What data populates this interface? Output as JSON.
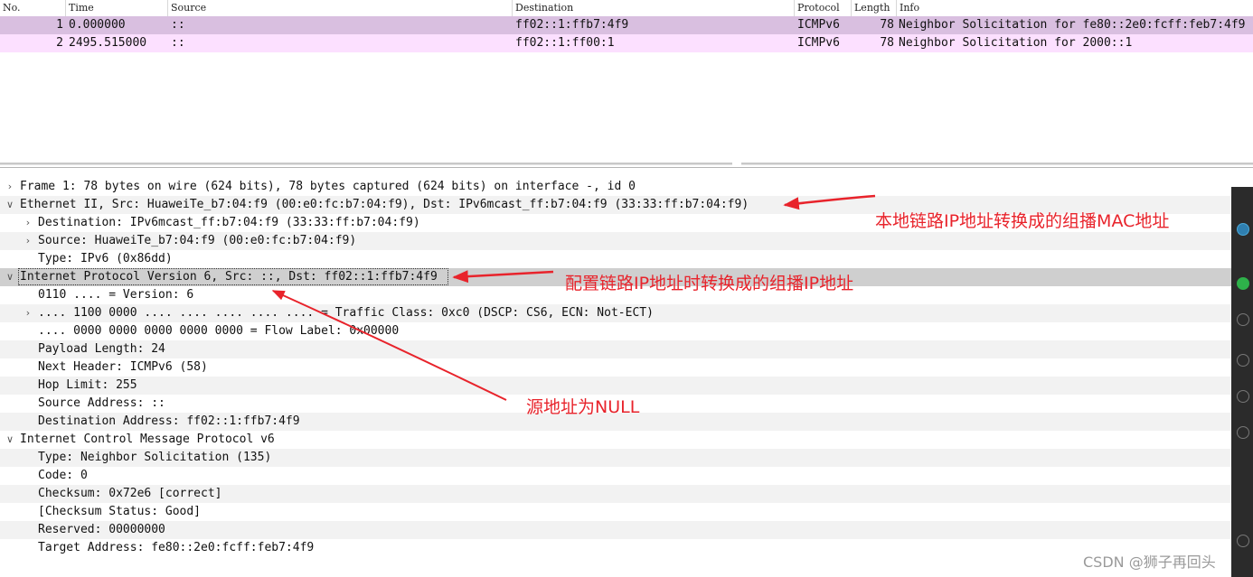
{
  "packet_list": {
    "columns": [
      "No.",
      "Time",
      "Source",
      "Destination",
      "Protocol",
      "Length",
      "Info"
    ],
    "rows": [
      {
        "no": "1",
        "time": "0.000000",
        "source": "::",
        "destination": "ff02::1:ffb7:4f9",
        "protocol": "ICMPv6",
        "length": "78",
        "info": "Neighbor Solicitation for fe80::2e0:fcff:feb7:4f9",
        "bg": "#d9bfe0"
      },
      {
        "no": "2",
        "time": "2495.515000",
        "source": "::",
        "destination": "ff02::1:ff00:1",
        "protocol": "ICMPv6",
        "length": "78",
        "info": "Neighbor Solicitation for 2000::1",
        "bg": "#fce0ff"
      }
    ]
  },
  "details": [
    {
      "text": "Frame 1: 78 bytes on wire (624 bits), 78 bytes captured (624 bits) on interface -, id 0",
      "indent": 0,
      "caret": "collapsed"
    },
    {
      "text": "Ethernet II, Src: HuaweiTe_b7:04:f9 (00:e0:fc:b7:04:f9), Dst: IPv6mcast_ff:b7:04:f9 (33:33:ff:b7:04:f9)",
      "indent": 0,
      "caret": "expanded"
    },
    {
      "text": "Destination: IPv6mcast_ff:b7:04:f9 (33:33:ff:b7:04:f9)",
      "indent": 1,
      "caret": "collapsed"
    },
    {
      "text": "Source: HuaweiTe_b7:04:f9 (00:e0:fc:b7:04:f9)",
      "indent": 1,
      "caret": "collapsed"
    },
    {
      "text": "Type: IPv6 (0x86dd)",
      "indent": 1,
      "caret": "none"
    },
    {
      "text": "Internet Protocol Version 6, Src: ::, Dst: ff02::1:ffb7:4f9",
      "indent": 0,
      "caret": "expanded",
      "selected": true
    },
    {
      "text": "0110 .... = Version: 6",
      "indent": 1,
      "caret": "none"
    },
    {
      "text": ".... 1100 0000 .... .... .... .... .... = Traffic Class: 0xc0 (DSCP: CS6, ECN: Not-ECT)",
      "indent": 1,
      "caret": "collapsed"
    },
    {
      "text": ".... 0000 0000 0000 0000 0000 = Flow Label: 0x00000",
      "indent": 1,
      "caret": "none"
    },
    {
      "text": "Payload Length: 24",
      "indent": 1,
      "caret": "none"
    },
    {
      "text": "Next Header: ICMPv6 (58)",
      "indent": 1,
      "caret": "none"
    },
    {
      "text": "Hop Limit: 255",
      "indent": 1,
      "caret": "none"
    },
    {
      "text": "Source Address: ::",
      "indent": 1,
      "caret": "none"
    },
    {
      "text": "Destination Address: ff02::1:ffb7:4f9",
      "indent": 1,
      "caret": "none"
    },
    {
      "text": "Internet Control Message Protocol v6",
      "indent": 0,
      "caret": "expanded"
    },
    {
      "text": "Type: Neighbor Solicitation (135)",
      "indent": 1,
      "caret": "none"
    },
    {
      "text": "Code: 0",
      "indent": 1,
      "caret": "none"
    },
    {
      "text": "Checksum: 0x72e6 [correct]",
      "indent": 1,
      "caret": "none"
    },
    {
      "text": "[Checksum Status: Good]",
      "indent": 1,
      "caret": "none"
    },
    {
      "text": "Reserved: 00000000",
      "indent": 1,
      "caret": "none"
    },
    {
      "text": "Target Address: fe80::2e0:fcff:feb7:4f9",
      "indent": 1,
      "caret": "none"
    }
  ],
  "annotations": {
    "mac_note": "本地链路IP地址转换成的组播MAC地址",
    "ip_note": "配置链路IP地址时转换成的组播IP地址",
    "null_note": "源地址为NULL",
    "color": "#e8232b"
  },
  "watermark": "CSDN @狮子再回头"
}
